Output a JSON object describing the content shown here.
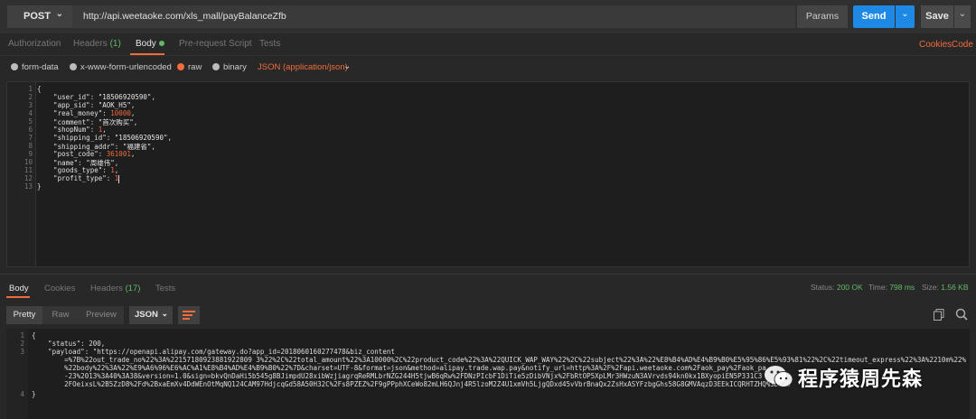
{
  "request": {
    "method": "POST",
    "url": "http://api.weetaoke.com/xls_mall/payBalanceZfb",
    "params_label": "Params",
    "send_label": "Send",
    "save_label": "Save"
  },
  "request_tabs": {
    "authorization": "Authorization",
    "headers": "Headers",
    "headers_count": "(1)",
    "body": "Body",
    "prerequest": "Pre-request Script",
    "tests": "Tests",
    "cookies": "Cookies",
    "code": "Code"
  },
  "body_options": {
    "form_data": "form-data",
    "urlencoded": "x-www-form-urlencoded",
    "raw": "raw",
    "binary": "binary",
    "content_type": "JSON (application/json)"
  },
  "editor": {
    "line_numbers": [
      "1",
      "2",
      "3",
      "4",
      "5",
      "6",
      "7",
      "8",
      "9",
      "10",
      "11",
      "12",
      "13"
    ],
    "l1": "{",
    "l2_key": "    \"user_id\"",
    "l2_val": "\"18506920590\"",
    "l3_key": "    \"app_sid\"",
    "l3_val": "\"AOK_H5\"",
    "l4_key": "    \"real_money\"",
    "l4_val": "10000",
    "l5_key": "    \"comment\"",
    "l5_val": "\"首次购买\"",
    "l6_key": "    \"shopNum\"",
    "l6_val": "1",
    "l7_key": "    \"shipping_id\"",
    "l7_val": "\"18506920590\"",
    "l8_key": "    \"shipping_addr\"",
    "l8_val": "\"福建省\"",
    "l9_key": "    \"post_code\"",
    "l9_val": "361001",
    "l10_key": "    \"name\"",
    "l10_val": "\"周雄伟\"",
    "l11_key": "    \"goods_type\"",
    "l11_val": "1",
    "l12_key": "    \"profit_type\"",
    "l12_val": "1",
    "l13": "}"
  },
  "response_tabs": {
    "body": "Body",
    "cookies": "Cookies",
    "headers": "Headers",
    "headers_count": "(17)",
    "tests": "Tests"
  },
  "response_meta": {
    "status_label": "Status:",
    "status_value": "200 OK",
    "time_label": "Time:",
    "time_value": "798 ms",
    "size_label": "Size:",
    "size_value": "1.56 KB"
  },
  "response_toolbar": {
    "pretty": "Pretty",
    "raw": "Raw",
    "preview": "Preview",
    "format": "JSON"
  },
  "response_body": {
    "line_numbers": [
      "1",
      "2",
      "3",
      "",
      "",
      "",
      "4"
    ],
    "r1": "{",
    "r2": "    \"status\": 200,",
    "r3": "    \"payload\": \"https://openapi.alipay.com/gateway.do?app_id=2018060160277478&biz_content",
    "r3b": "        =%7B%22out_trade_no%22%3A%22157180923881922809 3%22%2C%22total_amount%22%3A10000%2C%22product_code%22%3A%22QUICK_WAP_WAY%22%2C%22subject%22%3A%22%E8%B4%AD%E4%B9%B0%E5%95%86%E5%93%81%22%2C%22timeout_express%22%3A%2210m%22%2C",
    "r3c": "        %22body%22%3A%22%E9%A6%96%E6%AC%A1%E8%B4%AD%E4%B9%B0%22%7D&charset=UTF-8&format=json&method=alipay.trade.wap.pay&notify_url=http%3A%2F%2Fapi.weetaoke.com%2Faok_pay%2Faok_pa",
    "r3d": "        -23%2013%3A40%3A38&version=1.0&sign=bkvQnDaHi5b545g8BJimpdU28xibWzjiagrqReRMLbrNZG244H5tjwB6qRw%2FDNzPIcbF1DiTie5zDibVNjx%2FbRtOP5XpLMr3HWzuN3AVrvds94kn0kx1BXyopiEN5P331C3",
    "r3e": "        2FOeixsL%2B5ZzD8%2Fd%2BxaEmXv4DdWEnOtMqNQ124CAM97HdjcqGd58A50H32C%2Fs8PZEZ%2F9gPPphXCeWo82mLH6QJnj4R5lzoM2Z4U1xmVh5LjgQDxd45vVbrBnaQx2ZsHxASYFzbgGhs58G8GMVAqzD3EEkICQRHTZHQ%3D%3D",
    "r4": "}"
  },
  "watermark": {
    "text": "程序猿周先森"
  }
}
